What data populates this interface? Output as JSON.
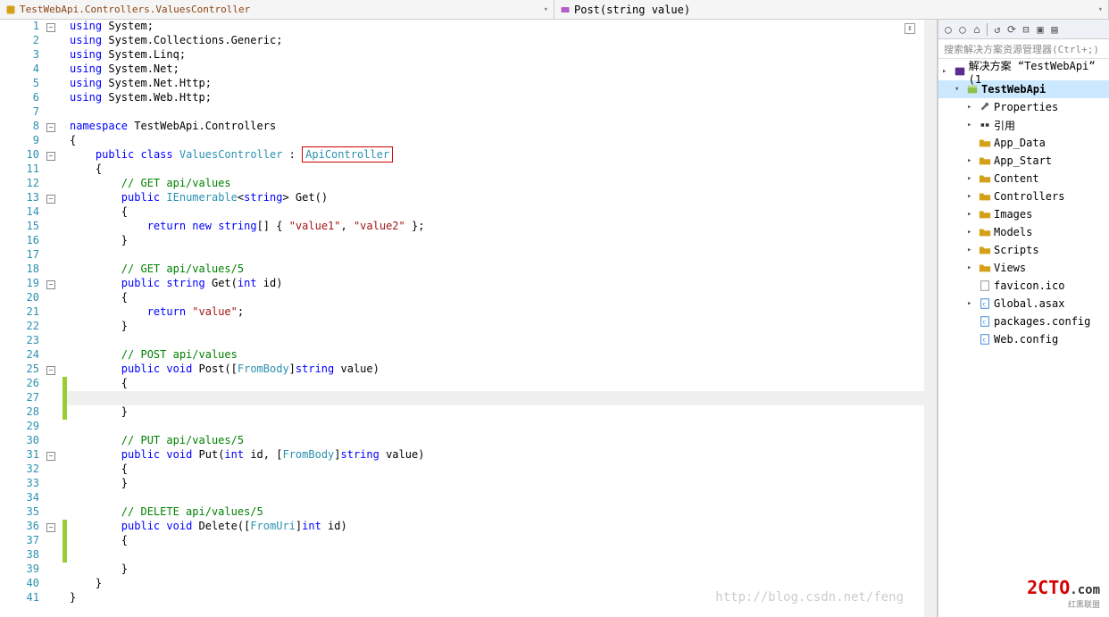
{
  "nav": {
    "left": "TestWebApi.Controllers.ValuesController",
    "right": "Post(string value)"
  },
  "gutter_lines": 41,
  "fold_lines": [
    1,
    8,
    10,
    13,
    19,
    25,
    31,
    36
  ],
  "change_ranges": [
    {
      "start": 26,
      "end": 28
    },
    {
      "start": 36,
      "end": 38
    }
  ],
  "current_line": 27,
  "code": [
    [
      {
        "t": "kw",
        "v": "using"
      },
      {
        "t": "",
        "v": " System;"
      }
    ],
    [
      {
        "t": "kw",
        "v": "using"
      },
      {
        "t": "",
        "v": " System.Collections.Generic;"
      }
    ],
    [
      {
        "t": "kw",
        "v": "using"
      },
      {
        "t": "",
        "v": " System.Linq;"
      }
    ],
    [
      {
        "t": "kw",
        "v": "using"
      },
      {
        "t": "",
        "v": " System.Net;"
      }
    ],
    [
      {
        "t": "kw",
        "v": "using"
      },
      {
        "t": "",
        "v": " System.Net.Http;"
      }
    ],
    [
      {
        "t": "kw",
        "v": "using"
      },
      {
        "t": "",
        "v": " System.Web.Http;"
      }
    ],
    [],
    [
      {
        "t": "kw",
        "v": "namespace"
      },
      {
        "t": "",
        "v": " TestWebApi.Controllers"
      }
    ],
    [
      {
        "t": "",
        "v": "{"
      }
    ],
    [
      {
        "t": "",
        "v": "    "
      },
      {
        "t": "kw",
        "v": "public"
      },
      {
        "t": "",
        "v": " "
      },
      {
        "t": "kw",
        "v": "class"
      },
      {
        "t": "",
        "v": " "
      },
      {
        "t": "type",
        "v": "ValuesController"
      },
      {
        "t": "",
        "v": " : "
      },
      {
        "t": "box",
        "v": "ApiController"
      }
    ],
    [
      {
        "t": "",
        "v": "    {"
      }
    ],
    [
      {
        "t": "",
        "v": "        "
      },
      {
        "t": "cmt",
        "v": "// GET api/values"
      }
    ],
    [
      {
        "t": "",
        "v": "        "
      },
      {
        "t": "kw",
        "v": "public"
      },
      {
        "t": "",
        "v": " "
      },
      {
        "t": "type",
        "v": "IEnumerable"
      },
      {
        "t": "",
        "v": "<"
      },
      {
        "t": "kw",
        "v": "string"
      },
      {
        "t": "",
        "v": "> Get()"
      }
    ],
    [
      {
        "t": "",
        "v": "        {"
      }
    ],
    [
      {
        "t": "",
        "v": "            "
      },
      {
        "t": "kw",
        "v": "return"
      },
      {
        "t": "",
        "v": " "
      },
      {
        "t": "kw",
        "v": "new"
      },
      {
        "t": "",
        "v": " "
      },
      {
        "t": "kw",
        "v": "string"
      },
      {
        "t": "",
        "v": "[] { "
      },
      {
        "t": "str",
        "v": "\"value1\""
      },
      {
        "t": "",
        "v": ", "
      },
      {
        "t": "str",
        "v": "\"value2\""
      },
      {
        "t": "",
        "v": " };"
      }
    ],
    [
      {
        "t": "",
        "v": "        }"
      }
    ],
    [],
    [
      {
        "t": "",
        "v": "        "
      },
      {
        "t": "cmt",
        "v": "// GET api/values/5"
      }
    ],
    [
      {
        "t": "",
        "v": "        "
      },
      {
        "t": "kw",
        "v": "public"
      },
      {
        "t": "",
        "v": " "
      },
      {
        "t": "kw",
        "v": "string"
      },
      {
        "t": "",
        "v": " Get("
      },
      {
        "t": "kw",
        "v": "int"
      },
      {
        "t": "",
        "v": " id)"
      }
    ],
    [
      {
        "t": "",
        "v": "        {"
      }
    ],
    [
      {
        "t": "",
        "v": "            "
      },
      {
        "t": "kw",
        "v": "return"
      },
      {
        "t": "",
        "v": " "
      },
      {
        "t": "str",
        "v": "\"value\""
      },
      {
        "t": "",
        "v": ";"
      }
    ],
    [
      {
        "t": "",
        "v": "        }"
      }
    ],
    [],
    [
      {
        "t": "",
        "v": "        "
      },
      {
        "t": "cmt",
        "v": "// POST api/values"
      }
    ],
    [
      {
        "t": "",
        "v": "        "
      },
      {
        "t": "kw",
        "v": "public"
      },
      {
        "t": "",
        "v": " "
      },
      {
        "t": "kw",
        "v": "void"
      },
      {
        "t": "",
        "v": " Post(["
      },
      {
        "t": "type",
        "v": "FromBody"
      },
      {
        "t": "",
        "v": "]"
      },
      {
        "t": "kw",
        "v": "string"
      },
      {
        "t": "",
        "v": " value)"
      }
    ],
    [
      {
        "t": "",
        "v": "        {"
      }
    ],
    [
      {
        "t": "",
        "v": "            "
      }
    ],
    [
      {
        "t": "",
        "v": "        }"
      }
    ],
    [],
    [
      {
        "t": "",
        "v": "        "
      },
      {
        "t": "cmt",
        "v": "// PUT api/values/5"
      }
    ],
    [
      {
        "t": "",
        "v": "        "
      },
      {
        "t": "kw",
        "v": "public"
      },
      {
        "t": "",
        "v": " "
      },
      {
        "t": "kw",
        "v": "void"
      },
      {
        "t": "",
        "v": " Put("
      },
      {
        "t": "kw",
        "v": "int"
      },
      {
        "t": "",
        "v": " id, ["
      },
      {
        "t": "type",
        "v": "FromBody"
      },
      {
        "t": "",
        "v": "]"
      },
      {
        "t": "kw",
        "v": "string"
      },
      {
        "t": "",
        "v": " value)"
      }
    ],
    [
      {
        "t": "",
        "v": "        {"
      }
    ],
    [
      {
        "t": "",
        "v": "        }"
      }
    ],
    [],
    [
      {
        "t": "",
        "v": "        "
      },
      {
        "t": "cmt",
        "v": "// DELETE api/values/5"
      }
    ],
    [
      {
        "t": "",
        "v": "        "
      },
      {
        "t": "kw",
        "v": "public"
      },
      {
        "t": "",
        "v": " "
      },
      {
        "t": "kw",
        "v": "void"
      },
      {
        "t": "",
        "v": " Delete(["
      },
      {
        "t": "type",
        "v": "FromUri"
      },
      {
        "t": "",
        "v": "]"
      },
      {
        "t": "kw",
        "v": "int"
      },
      {
        "t": "",
        "v": " id)"
      }
    ],
    [
      {
        "t": "",
        "v": "        {"
      }
    ],
    [
      {
        "t": "",
        "v": "            "
      }
    ],
    [
      {
        "t": "",
        "v": "        }"
      }
    ],
    [
      {
        "t": "",
        "v": "    }"
      }
    ],
    [
      {
        "t": "",
        "v": "}"
      }
    ]
  ],
  "search_placeholder": "搜索解决方案资源管理器(Ctrl+;)",
  "solution_label": "解决方案 “TestWebApi” (1",
  "tree": [
    {
      "depth": 0,
      "arrow": "▸",
      "icon": "sln",
      "label": "解决方案 “TestWebApi” (1",
      "sel": false,
      "bold": false
    },
    {
      "depth": 1,
      "arrow": "▾",
      "icon": "proj",
      "label": "TestWebApi",
      "sel": true,
      "bold": true
    },
    {
      "depth": 2,
      "arrow": "▸",
      "icon": "wrench",
      "label": "Properties",
      "sel": false
    },
    {
      "depth": 2,
      "arrow": "▸",
      "icon": "ref",
      "label": "引用",
      "sel": false
    },
    {
      "depth": 2,
      "arrow": "",
      "icon": "folder",
      "label": "App_Data",
      "sel": false
    },
    {
      "depth": 2,
      "arrow": "▸",
      "icon": "folder",
      "label": "App_Start",
      "sel": false
    },
    {
      "depth": 2,
      "arrow": "▸",
      "icon": "folder",
      "label": "Content",
      "sel": false
    },
    {
      "depth": 2,
      "arrow": "▸",
      "icon": "folder",
      "label": "Controllers",
      "sel": false
    },
    {
      "depth": 2,
      "arrow": "▸",
      "icon": "folder",
      "label": "Images",
      "sel": false
    },
    {
      "depth": 2,
      "arrow": "▸",
      "icon": "folder",
      "label": "Models",
      "sel": false
    },
    {
      "depth": 2,
      "arrow": "▸",
      "icon": "folder",
      "label": "Scripts",
      "sel": false
    },
    {
      "depth": 2,
      "arrow": "▸",
      "icon": "folder",
      "label": "Views",
      "sel": false
    },
    {
      "depth": 2,
      "arrow": "",
      "icon": "file",
      "label": "favicon.ico",
      "sel": false
    },
    {
      "depth": 2,
      "arrow": "▸",
      "icon": "cs",
      "label": "Global.asax",
      "sel": false
    },
    {
      "depth": 2,
      "arrow": "",
      "icon": "cs",
      "label": "packages.config",
      "sel": false
    },
    {
      "depth": 2,
      "arrow": "",
      "icon": "cs",
      "label": "Web.config",
      "sel": false
    }
  ],
  "watermark_url": "http://blog.csdn.net/feng",
  "watermark_logo_a": "2CT",
  "watermark_logo_b": "O",
  "watermark_logo_c": ".com",
  "watermark_sub": "红黑联盟"
}
